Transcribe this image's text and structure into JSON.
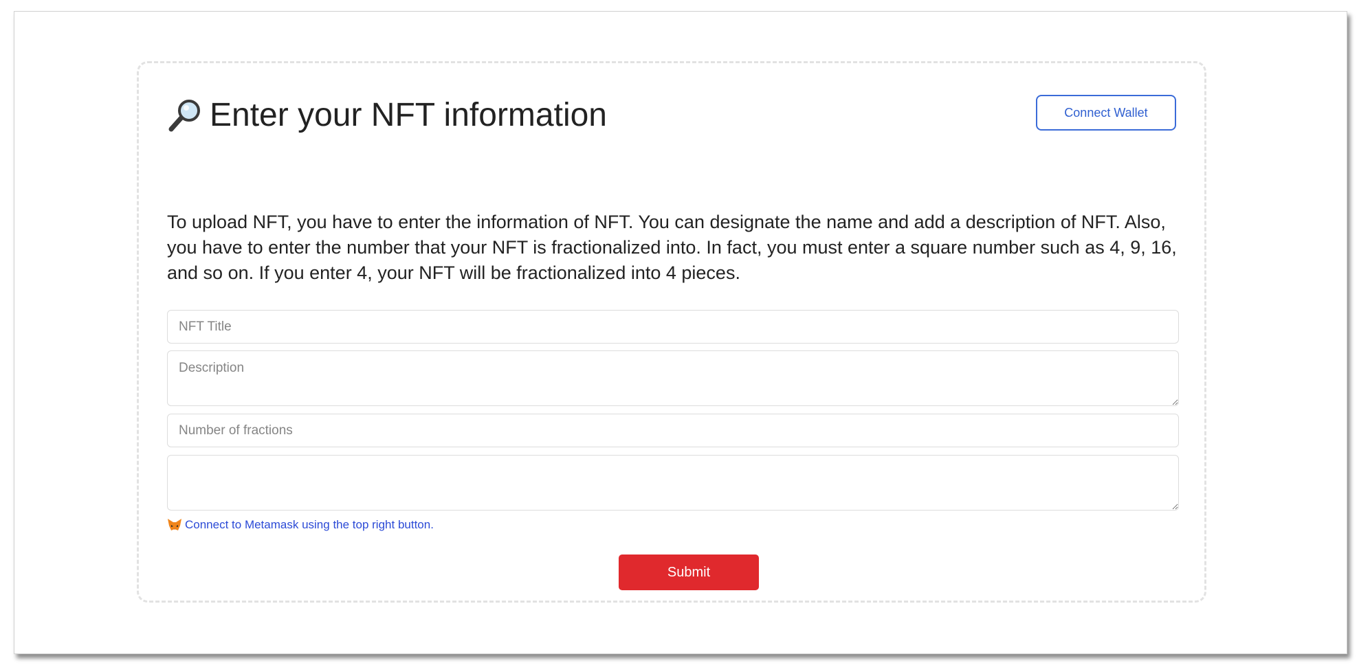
{
  "header": {
    "title": "Enter your NFT information",
    "title_icon": "magnifying-glass-icon",
    "connect_wallet_label": "Connect Wallet"
  },
  "intro": {
    "text": "To upload NFT, you have to enter the information of NFT. You can designate the name and add a description of NFT. Also, you have to enter the number that your NFT is fractionalized into. In fact, you must enter a square number such as 4, 9, 16, and so on. If you enter 4, your NFT will be fractionalized into 4 pieces."
  },
  "form": {
    "title_placeholder": "NFT Title",
    "description_placeholder": "Description",
    "fractions_placeholder": "Number of fractions",
    "extra_placeholder": "",
    "hint_icon": "metamask-fox-icon",
    "hint_text": "Connect to Metamask using the top right button.",
    "submit_label": "Submit"
  },
  "colors": {
    "accent_blue": "#2f5fd0",
    "submit_red": "#e0292d",
    "hint_blue": "#2b4ad6"
  }
}
